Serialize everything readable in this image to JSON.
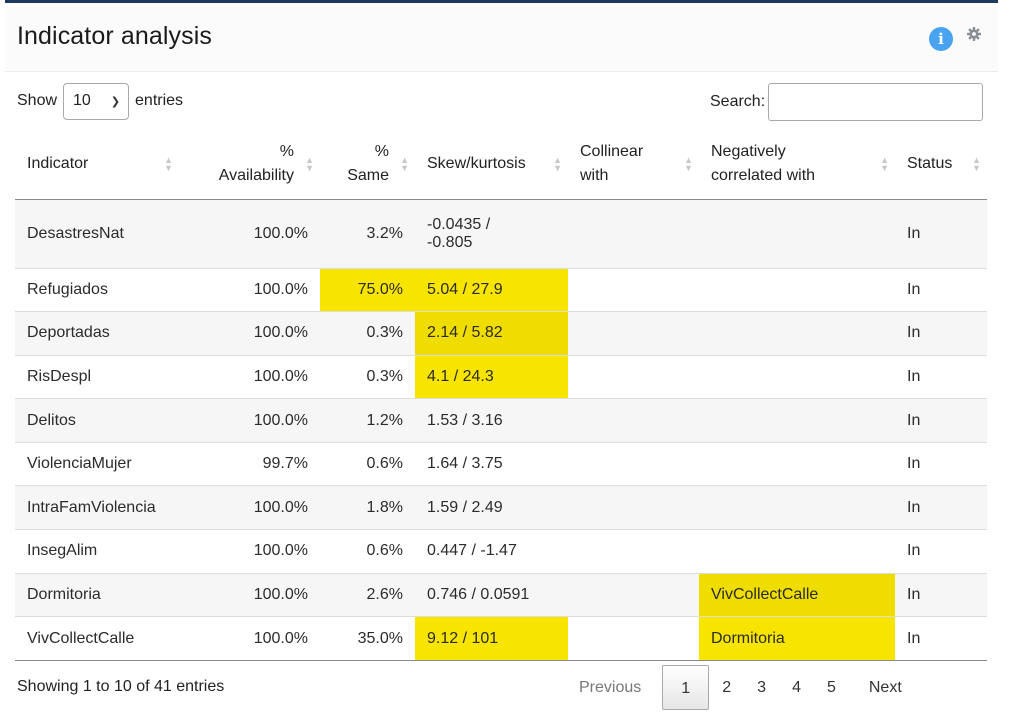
{
  "header": {
    "title": "Indicator analysis",
    "info_icon": "info-icon",
    "settings_icon": "gear-icon",
    "info_glyph": "i",
    "accent_color": "#4aa3f0",
    "header_border_color": "#1f3a5f"
  },
  "controls": {
    "show_label": "Show",
    "entries_value": "10",
    "entries_label": "entries",
    "search_label": "Search:",
    "search_value": ""
  },
  "table": {
    "headers": {
      "indicator": "Indicator",
      "availability_line1": "%",
      "availability_line2": "Availability",
      "same_line1": "%",
      "same_line2": "Same",
      "skew": "Skew/kurtosis",
      "collinear_line1": "Collinear",
      "collinear_line2": "with",
      "negcorr_line1": "Negatively",
      "negcorr_line2": "correlated with",
      "status": "Status"
    },
    "highlight_color": "#f7e500",
    "rows": [
      {
        "indicator": "DesastresNat",
        "availability": "100.0%",
        "same": "3.2%",
        "skew_line1": "-0.0435 /",
        "skew_line2": "-0.805",
        "collinear": "",
        "negcorr": "",
        "status": "In"
      },
      {
        "indicator": "Refugiados",
        "availability": "100.0%",
        "same": "75.0%",
        "skew": "5.04 / 27.9",
        "collinear": "",
        "negcorr": "",
        "status": "In"
      },
      {
        "indicator": "Deportadas",
        "availability": "100.0%",
        "same": "0.3%",
        "skew": "2.14 / 5.82",
        "collinear": "",
        "negcorr": "",
        "status": "In"
      },
      {
        "indicator": "RisDespl",
        "availability": "100.0%",
        "same": "0.3%",
        "skew": "4.1 / 24.3",
        "collinear": "",
        "negcorr": "",
        "status": "In"
      },
      {
        "indicator": "Delitos",
        "availability": "100.0%",
        "same": "1.2%",
        "skew": "1.53 / 3.16",
        "collinear": "",
        "negcorr": "",
        "status": "In"
      },
      {
        "indicator": "ViolenciaMujer",
        "availability": "99.7%",
        "same": "0.6%",
        "skew": "1.64 / 3.75",
        "collinear": "",
        "negcorr": "",
        "status": "In"
      },
      {
        "indicator": "IntraFamViolencia",
        "availability": "100.0%",
        "same": "1.8%",
        "skew": "1.59 / 2.49",
        "collinear": "",
        "negcorr": "",
        "status": "In"
      },
      {
        "indicator": "InsegAlim",
        "availability": "100.0%",
        "same": "0.6%",
        "skew": "0.447 / -1.47",
        "collinear": "",
        "negcorr": "",
        "status": "In"
      },
      {
        "indicator": "Dormitoria",
        "availability": "100.0%",
        "same": "2.6%",
        "skew": "0.746 / 0.0591",
        "collinear": "",
        "negcorr": "VivCollectCalle",
        "status": "In"
      },
      {
        "indicator": "VivCollectCalle",
        "availability": "100.0%",
        "same": "35.0%",
        "skew": "9.12 / 101",
        "collinear": "",
        "negcorr": "Dormitoria",
        "status": "In"
      }
    ]
  },
  "footer": {
    "info": "Showing 1 to 10 of 41 entries",
    "previous": "Previous",
    "pages": [
      "1",
      "2",
      "3",
      "4",
      "5"
    ],
    "current_page": "1",
    "next": "Next"
  }
}
